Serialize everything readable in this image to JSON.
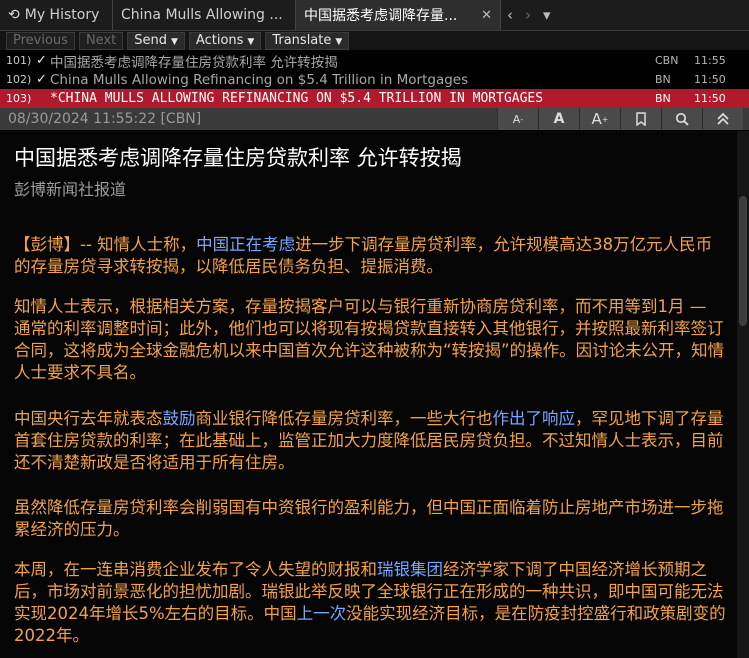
{
  "tabs": {
    "history_label": "My History",
    "china_label": "China Mulls Allowing ...",
    "active_label": "中国据悉考虑调降存量...",
    "close_glyph": "✕"
  },
  "toolbar": {
    "previous": "Previous",
    "next": "Next",
    "send": "Send",
    "actions": "Actions",
    "translate": "Translate"
  },
  "headlines": [
    {
      "num": "101)",
      "check": "✓",
      "title": "中国据悉考虑调降存量住房贷款利率 允许转按揭",
      "source": "CBN",
      "time": "11:55"
    },
    {
      "num": "102)",
      "check": "✓",
      "title": "China Mulls Allowing Refinancing on $5.4 Trillion in Mortgages",
      "source": "BN",
      "time": "11:50"
    },
    {
      "num": "103)",
      "check": "",
      "title": "*CHINA MULLS ALLOWING REFINANCING ON $5.4 TRILLION IN MORTGAGES",
      "source": "BN",
      "time": "11:50"
    }
  ],
  "meta": {
    "datetime_source": "08/30/2024 11:55:22 [CBN]",
    "font_decrease": "A",
    "font_normal": "A",
    "font_increase": "A"
  },
  "article": {
    "title": "中国据悉考虑调降存量住房贷款利率 允许转按揭",
    "byline": "彭博新闻社报道",
    "p1_a": "【彭博】-- 知情人士称，",
    "p1_b": "中国正在考虑",
    "p1_c": "进一步下调存量房贷利率，允许规模高达38万亿元人民币的存量房贷寻求转按揭，以降低居民债务负担、提振消费。",
    "p2": "知情人士表示，根据相关方案，存量按揭客户可以与银行重新协商房贷利率，而不用等到1月 — 通常的利率调整时间；此外，他们也可以将现有按揭贷款直接转入其他银行，并按照最新利率签订合同，这将成为全球金融危机以来中国首次允许这种被称为“转按揭”的操作。因讨论未公开，知情人士要求不具名。",
    "p3_a": "中国央行去年就表态",
    "p3_b": "鼓励",
    "p3_c": "商业银行降低存量房贷利率，一些大行也",
    "p3_d": "作出了响应",
    "p3_e": "，罕见地下调了存量首套住房贷款的利率；在此基础上，监管正加大力度降低居民房贷负担。不过知情人士表示，目前还不清楚新政是否将适用于所有住房。",
    "p4": "虽然降低存量房贷利率会削弱国有中资银行的盈利能力，但中国正面临着防止房地产市场进一步拖累经济的压力。",
    "p5_a": "本周，在一连串消费企业发布了令人失望的财报和",
    "p5_b": "瑞银集团",
    "p5_c": "经济学家下调了中国经济增长预期之后，市场对前景恶化的担忧加剧。瑞银此举反映了全球银行正在形成的一种共识，即中国可能无法实现2024年增长5%左右的目标。中国",
    "p5_d": "上一次",
    "p5_e": "没能实现经济目标，是在防疫封控盛行和政策剧变的2022年。"
  },
  "colors": {
    "body_text": "#f3a24a",
    "link_text": "#79a6ff",
    "selected_row": "#b01a2a"
  }
}
